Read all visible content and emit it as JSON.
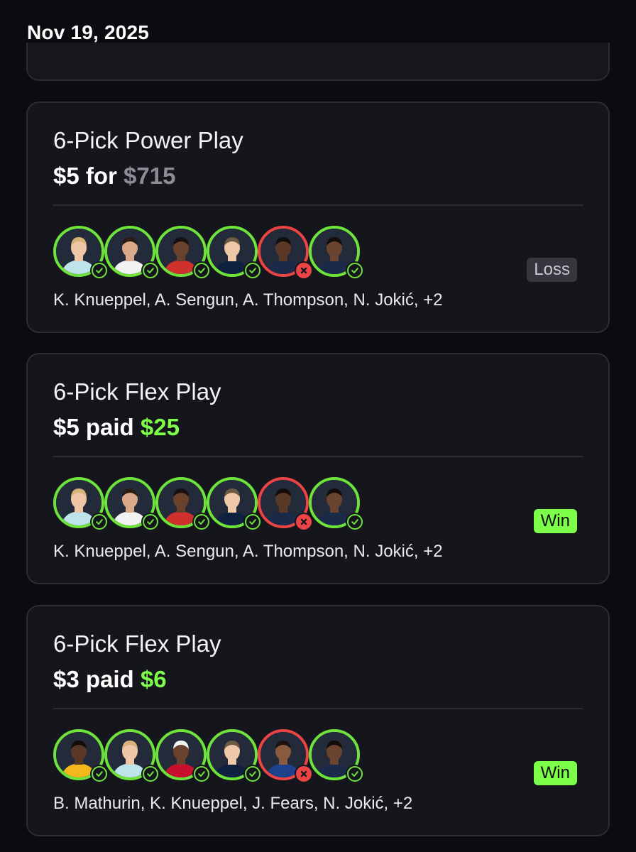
{
  "header": {
    "date": "Nov 19, 2025"
  },
  "cards": [
    {
      "title": "6-Pick Power Play",
      "amount_prefix": "$5 for",
      "amount_value": "$715",
      "amount_style": "muted",
      "status": "Loss",
      "players_text": "K. Knueppel, A. Sengun, A. Thompson, N. Jokić, +2",
      "picks": [
        {
          "result": "hit",
          "skin": "#f0c7a6",
          "jersey": "#bfe3ea",
          "hair": "#d9b27a"
        },
        {
          "result": "hit",
          "skin": "#d9a98a",
          "jersey": "#f2f2f2",
          "hair": "#2a1d16"
        },
        {
          "result": "hit",
          "skin": "#6a412a",
          "jersey": "#d0312d",
          "hair": "#161111"
        },
        {
          "result": "hit",
          "skin": "#efc8a8",
          "jersey": "#0e2240",
          "hair": "#6d5a45"
        },
        {
          "result": "miss",
          "skin": "#5a3826",
          "jersey": "#1a2a48",
          "hair": "#120d0b"
        },
        {
          "result": "hit",
          "skin": "#6b4430",
          "jersey": "#1a2a48",
          "hair": "#120d0b"
        }
      ]
    },
    {
      "title": "6-Pick Flex Play",
      "amount_prefix": "$5 paid",
      "amount_value": "$25",
      "amount_style": "win",
      "status": "Win",
      "players_text": "K. Knueppel, A. Sengun, A. Thompson, N. Jokić, +2",
      "picks": [
        {
          "result": "hit",
          "skin": "#f0c7a6",
          "jersey": "#bfe3ea",
          "hair": "#d9b27a"
        },
        {
          "result": "hit",
          "skin": "#d9a98a",
          "jersey": "#f2f2f2",
          "hair": "#2a1d16"
        },
        {
          "result": "hit",
          "skin": "#6a412a",
          "jersey": "#d0312d",
          "hair": "#161111"
        },
        {
          "result": "hit",
          "skin": "#efc8a8",
          "jersey": "#0e2240",
          "hair": "#6d5a45"
        },
        {
          "result": "miss",
          "skin": "#5a3826",
          "jersey": "#1a2a48",
          "hair": "#120d0b"
        },
        {
          "result": "hit",
          "skin": "#6b4430",
          "jersey": "#1a2a48",
          "hair": "#120d0b"
        }
      ]
    },
    {
      "title": "6-Pick Flex Play",
      "amount_prefix": "$3 paid",
      "amount_value": "$6",
      "amount_style": "win",
      "status": "Win",
      "players_text": "B. Mathurin, K. Knueppel, J. Fears, N. Jokić, +2",
      "picks": [
        {
          "result": "hit",
          "skin": "#5a3826",
          "jersey": "#f2b81c",
          "hair": "#120d0b"
        },
        {
          "result": "hit",
          "skin": "#f0c7a6",
          "jersey": "#bfe3ea",
          "hair": "#d9b27a"
        },
        {
          "result": "hit",
          "skin": "#6a412a",
          "jersey": "#c8102e",
          "hair": "#f2f2f2"
        },
        {
          "result": "hit",
          "skin": "#efc8a8",
          "jersey": "#0e2240",
          "hair": "#6d5a45"
        },
        {
          "result": "miss",
          "skin": "#8a5a3e",
          "jersey": "#1d428a",
          "hair": "#1a120e"
        },
        {
          "result": "hit",
          "skin": "#6b4430",
          "jersey": "#1a2a48",
          "hair": "#120d0b"
        }
      ]
    }
  ],
  "colors": {
    "win": "#7dff4a",
    "hit_ring": "#6ee33b",
    "miss_ring": "#ec4444",
    "card_bg": "#15151c"
  }
}
